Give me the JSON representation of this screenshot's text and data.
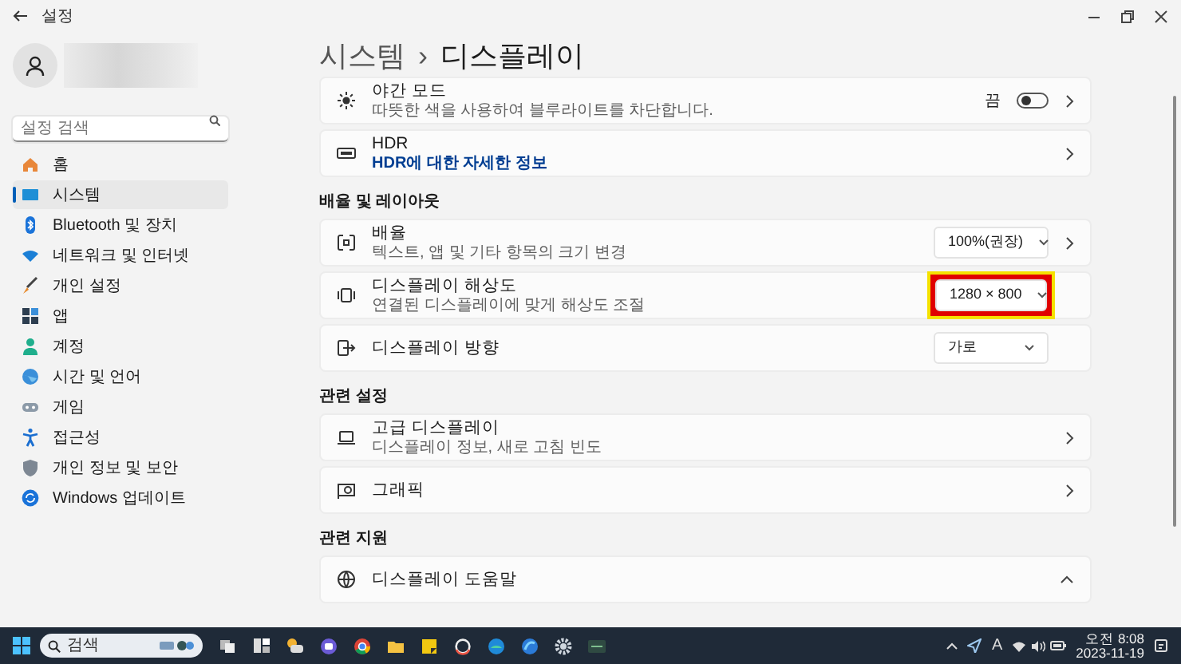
{
  "window": {
    "title": "설정"
  },
  "sidebar": {
    "search": {
      "placeholder": "설정 검색"
    },
    "items": [
      {
        "label": "홈",
        "selected": false
      },
      {
        "label": "시스템",
        "selected": true
      },
      {
        "label": "Bluetooth 및 장치",
        "selected": false
      },
      {
        "label": "네트워크 및 인터넷",
        "selected": false
      },
      {
        "label": "개인 설정",
        "selected": false
      },
      {
        "label": "앱",
        "selected": false
      },
      {
        "label": "계정",
        "selected": false
      },
      {
        "label": "시간 및 언어",
        "selected": false
      },
      {
        "label": "게임",
        "selected": false
      },
      {
        "label": "접근성",
        "selected": false
      },
      {
        "label": "개인 정보 및 보안",
        "selected": false
      },
      {
        "label": "Windows 업데이트",
        "selected": false
      }
    ]
  },
  "page": {
    "breadcrumb": [
      "시스템",
      "디스플레이"
    ],
    "separator": "›"
  },
  "sections": [
    {
      "cards": [
        {
          "kind": "toggle",
          "title": "야간 모드",
          "subtitle": "따뜻한 색을 사용하여 블루라이트를 차단합니다.",
          "state_label": "끔",
          "on": false
        },
        {
          "kind": "nav",
          "title": "HDR",
          "link": "HDR에 대한 자세한 정보"
        }
      ]
    },
    {
      "heading": "배율 및 레이아웃",
      "cards": [
        {
          "kind": "dropdown",
          "title": "배율",
          "subtitle": "텍스트, 앱 및 기타 항목의 크기 변경",
          "value": "100%(권장)",
          "chevron": true,
          "highlighted": false
        },
        {
          "kind": "dropdown",
          "title": "디스플레이 해상도",
          "subtitle": "연결된 디스플레이에 맞게 해상도 조절",
          "value": "1280 × 800",
          "chevron": false,
          "highlighted": true
        },
        {
          "kind": "dropdown",
          "title": "디스플레이 방향",
          "value": "가로",
          "chevron": false,
          "highlighted": false
        }
      ]
    },
    {
      "heading": "관련 설정",
      "cards": [
        {
          "kind": "nav",
          "title": "고급 디스플레이",
          "subtitle": "디스플레이 정보, 새로 고침 빈도"
        },
        {
          "kind": "nav",
          "title": "그래픽"
        }
      ]
    },
    {
      "heading": "관련 지원",
      "cards": [
        {
          "kind": "expander",
          "title": "디스플레이 도움말",
          "expanded": true
        }
      ]
    }
  ],
  "taskbar": {
    "search_placeholder": "검색",
    "input_indicator": "A",
    "time": "오전 8:08",
    "date": "2023-11-19"
  }
}
